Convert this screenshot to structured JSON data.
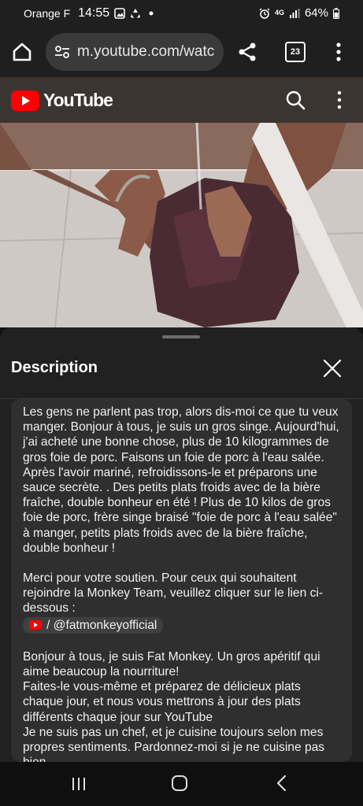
{
  "status_bar": {
    "carrier": "Orange F",
    "time": "14:55",
    "network": "4G",
    "battery": "64%"
  },
  "browser": {
    "url": "m.youtube.com/watc",
    "tab_count": "23"
  },
  "youtube": {
    "logo_text": "YouTube"
  },
  "sheet": {
    "title": "Description",
    "paragraph1": "Les gens ne parlent pas trop, alors dis-moi ce que tu veux manger. Bonjour à tous, je suis un gros singe. Aujourd'hui, j'ai acheté une bonne chose, plus de 10 kilogrammes de gros foie de porc. Faisons un foie de porc à l'eau salée. Après l'avoir mariné, refroidissons-le et préparons une sauce secrète. . Des petits plats froids avec de la bière fraîche, double bonheur en été ! Plus de 10 kilos de gros foie de porc, frère singe braisé \"foie de porc à l'eau salée\" à manger, petits plats froids avec de la bière fraîche, double bonheur !",
    "paragraph2": "Merci pour votre soutien. Pour ceux qui souhaitent rejoindre la Monkey Team, veuillez cliquer sur le lien ci-dessous :",
    "channel_link": "/ @fatmonkeyofficial",
    "paragraph3_line1": "Bonjour à tous, je suis Fat Monkey. Un gros apéritif qui aime beaucoup la nourriture!",
    "paragraph3_line2": "Faites-le vous-même et préparez de délicieux plats chaque jour, et nous vous mettrons à jour des plats différents chaque jour sur YouTube",
    "paragraph3_line3": "Je ne suis pas un chef, et je cuisine toujours selon mes propres sentiments. Pardonnez-moi si je ne cuisine pas bien."
  },
  "colors": {
    "youtube_red": "#ff0000",
    "sheet_bg": "#212121",
    "description_box_bg": "#2f2f2f",
    "browser_bar_bg": "#1f1f1f"
  },
  "icons": [
    "home-icon",
    "site-settings-icon",
    "share-icon",
    "tabs-icon",
    "more-vert-icon",
    "search-icon",
    "close-icon",
    "recents-icon",
    "home-nav-icon",
    "back-icon"
  ]
}
